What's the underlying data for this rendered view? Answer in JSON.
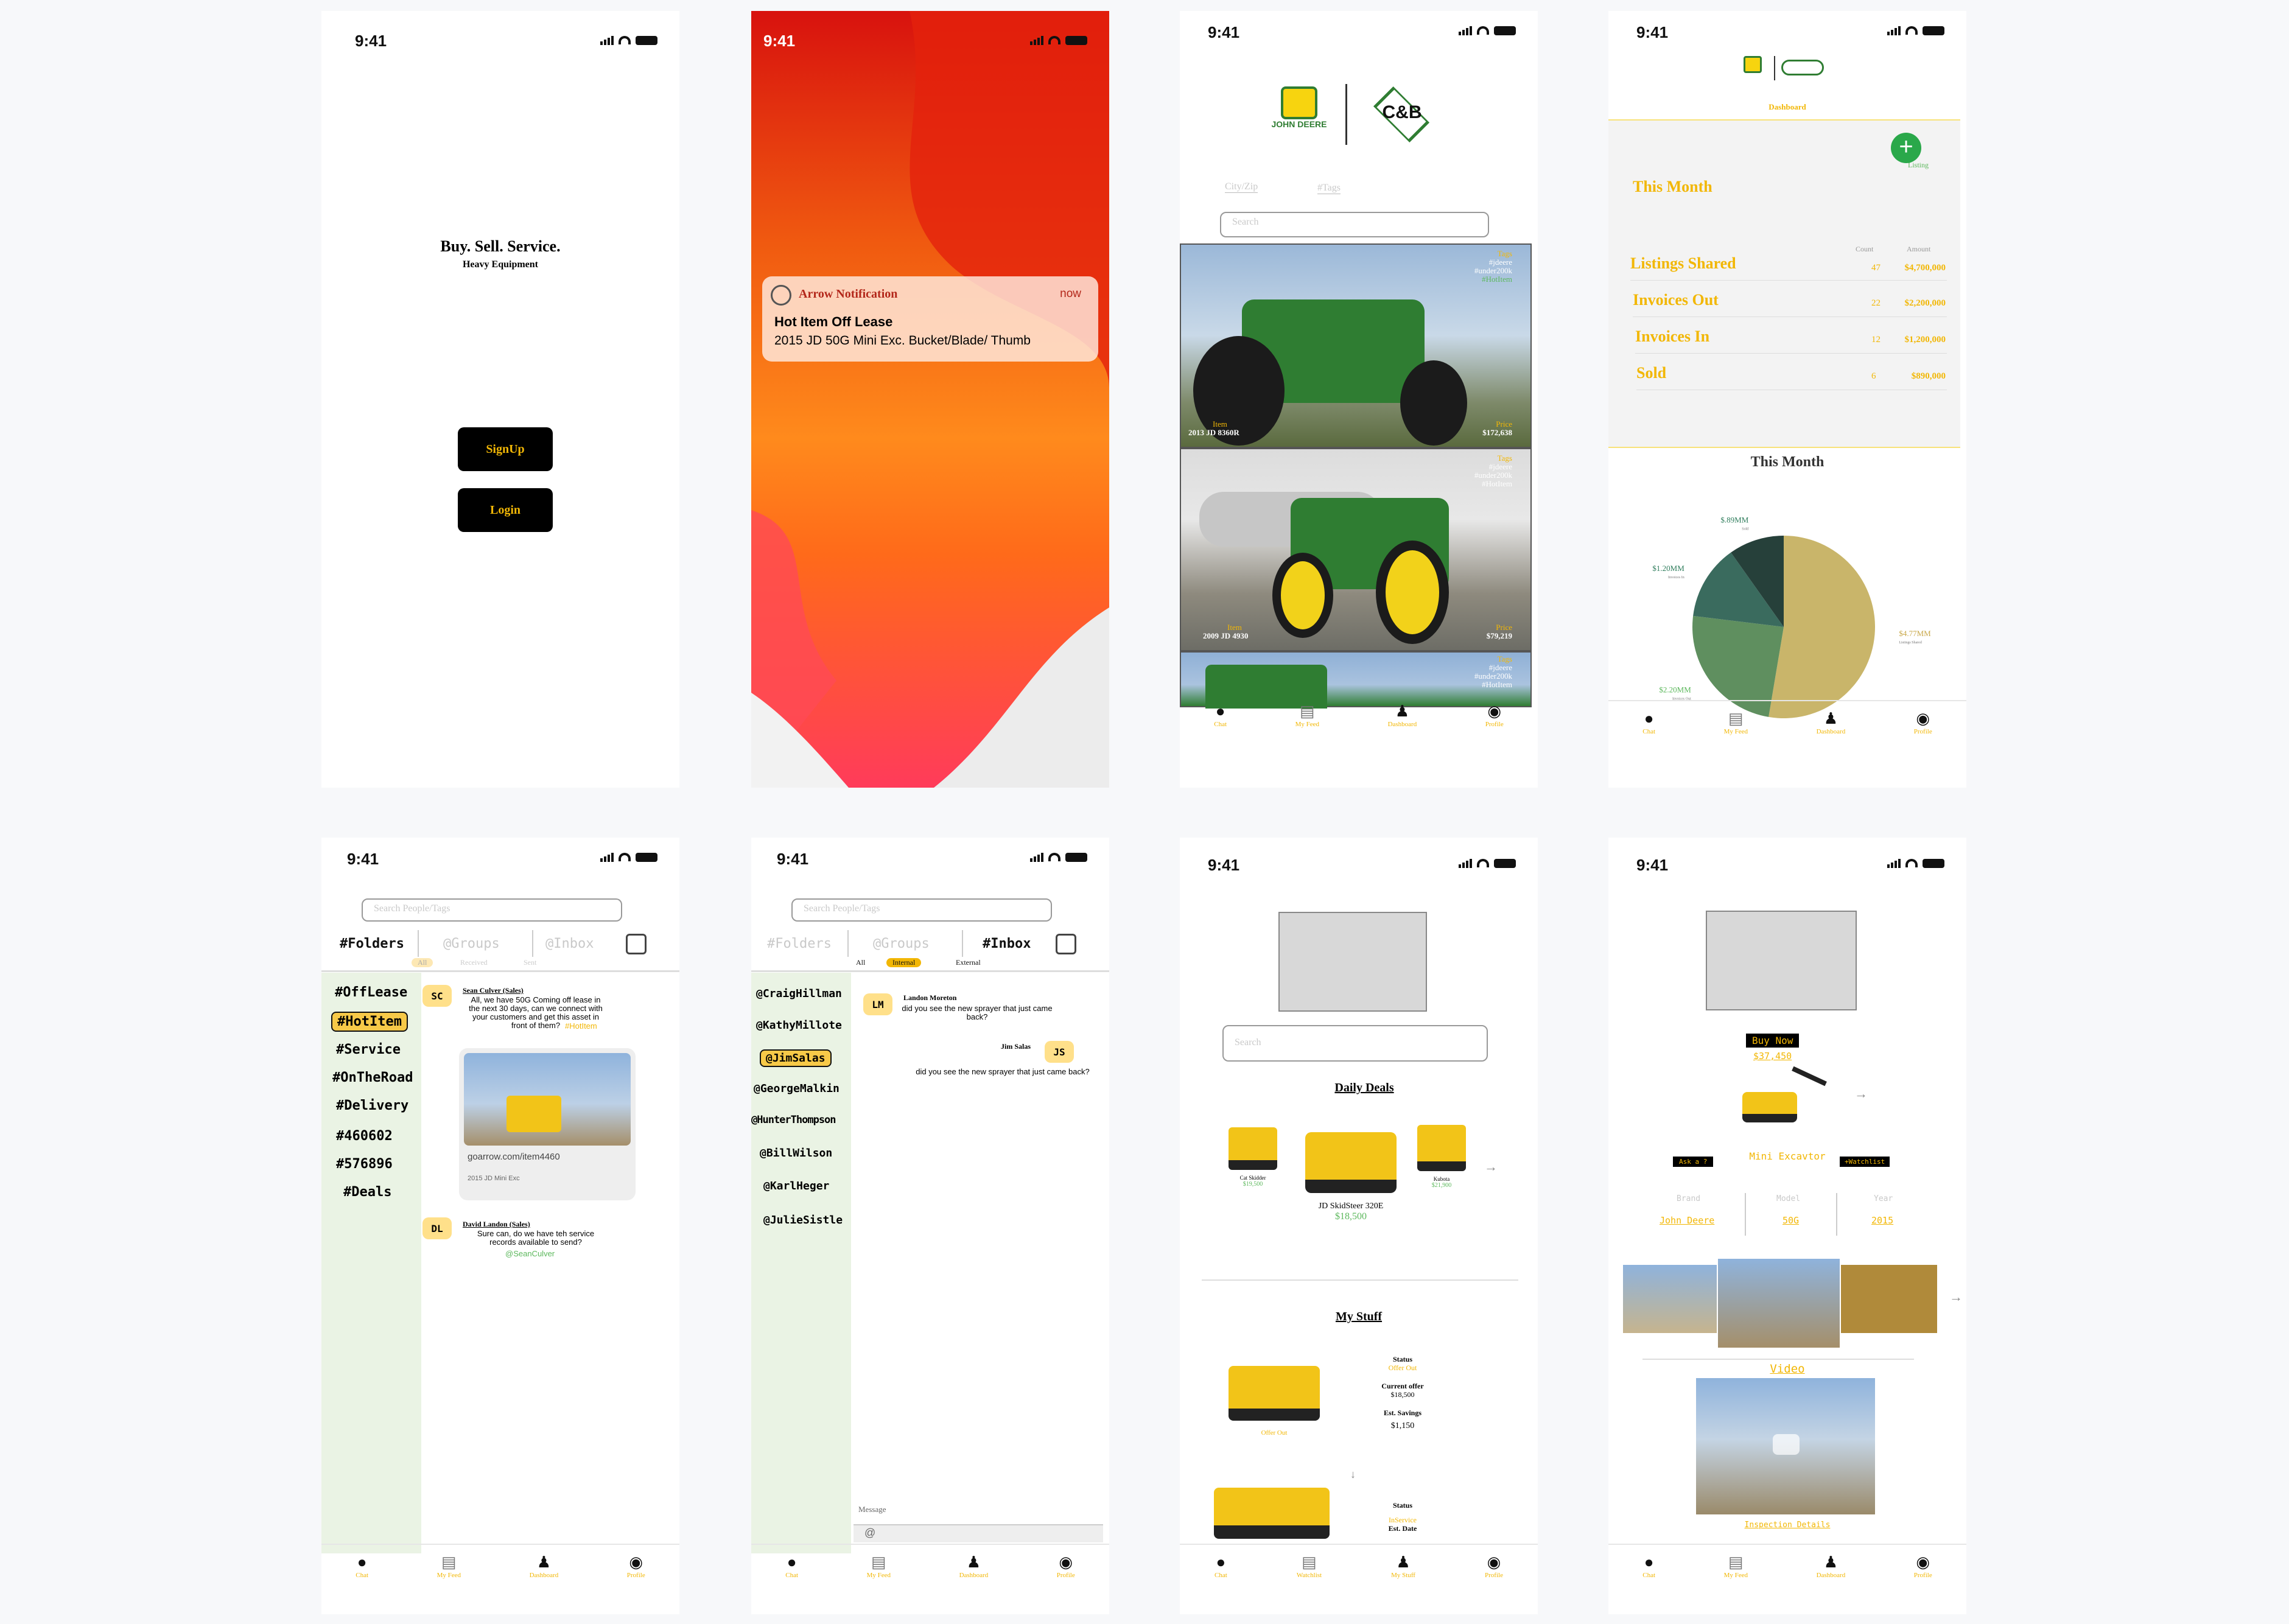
{
  "status_time": "9:41",
  "colors": {
    "accent_yellow": "#f2b705",
    "accent_green": "#5cb85c",
    "sidebar_bg": "#eaf3e4",
    "pie_tan": "#c9b56a",
    "pie_green": "#5f8f5f",
    "pie_teal": "#3a6b5e",
    "pie_dark": "#26403a"
  },
  "tabs_main": [
    {
      "label": "Chat",
      "icon": "chat-bubble-icon"
    },
    {
      "label": "My Feed",
      "icon": "feed-icon"
    },
    {
      "label": "Dashboard",
      "icon": "worker-icon"
    },
    {
      "label": "Profile",
      "icon": "profile-icon"
    }
  ],
  "tabs_mystuff": [
    {
      "label": "Chat",
      "icon": "chat-bubble-icon"
    },
    {
      "label": "Watchlist",
      "icon": "feed-icon"
    },
    {
      "label": "My Stuff",
      "icon": "worker-icon"
    },
    {
      "label": "Profile",
      "icon": "profile-icon"
    }
  ],
  "screen1": {
    "tagline": "Buy. Sell. Service.",
    "subtitle": "Heavy Equipment",
    "signup": "SignUp",
    "login": "Login"
  },
  "screen2": {
    "app": "Arrow Notification",
    "time": "now",
    "title": "Hot Item Off Lease",
    "body": "2015 JD 50G Mini Exc. Bucket/Blade/ Thumb"
  },
  "screen3": {
    "brand1": "JOHN DEERE",
    "brand2": "C&B",
    "filter_city": "City/Zip",
    "filter_tags": "#Tags",
    "search_placeholder": "Search",
    "listings": [
      {
        "tags_label": "Tags",
        "tags": [
          "#jdeere",
          "#under200k",
          "#HotItem"
        ],
        "item_label": "Item",
        "item": "2013 JD 8360R",
        "price_label": "Price",
        "price": "$172,638"
      },
      {
        "tags_label": "Tags",
        "tags": [
          "#jdeere",
          "#under200k",
          "#HotItem"
        ],
        "item_label": "Item",
        "item": "2009 JD 4930",
        "price_label": "Price",
        "price": "$79,219"
      },
      {
        "tags_label": "Tags",
        "tags": [
          "#jdeere",
          "#under200k",
          "#HotItem"
        ]
      }
    ]
  },
  "screen4": {
    "dashboard_label": "Dashboard",
    "listing_label": "Listing",
    "period": "This Month",
    "col_count": "Count",
    "col_amount": "Amount",
    "rows": [
      {
        "label": "Listings Shared",
        "count": "47",
        "amount": "$4,700,000"
      },
      {
        "label": "Invoices Out",
        "count": "22",
        "amount": "$2,200,000"
      },
      {
        "label": "Invoices In",
        "count": "12",
        "amount": "$1,200,000"
      },
      {
        "label": "Sold",
        "count": "6",
        "amount": "$890,000"
      }
    ],
    "chart_title": "This Month",
    "chart_data": {
      "type": "pie",
      "title": "This Month",
      "labels": [
        "$4.77MM",
        "$2.20MM",
        "$1.20MM",
        "$.89MM"
      ],
      "sublabels": [
        "Listings Shared",
        "Invoices Out",
        "Invoices In",
        "Sold"
      ],
      "values": [
        4.77,
        2.2,
        1.2,
        0.89
      ]
    }
  },
  "screen5": {
    "search_placeholder": "Search People/Tags",
    "tabs": [
      "#Folders",
      "@Groups",
      "@Inbox"
    ],
    "filters": [
      "All",
      "Received",
      "Sent"
    ],
    "folders": [
      "#OffLease",
      "#HotItem",
      "#Service",
      "#OnTheRoad",
      "#Delivery",
      "#460602",
      "#576896",
      "#Deals"
    ],
    "msg1": {
      "initials": "SC",
      "name": "Sean Culver (Sales)",
      "text": "All, we have 50G Coming off lease in the next 30 days, can we connect with your customers and get this asset in front of them?",
      "tag": "#HotItem",
      "link": "goarrow.com/item4460",
      "caption": "2015 JD Mini Exc"
    },
    "msg2": {
      "initials": "DL",
      "name": "David Landon (Sales)",
      "text": "Sure can, do we have teh service records available to send?",
      "mention": "@SeanCulver"
    }
  },
  "screen6": {
    "search_placeholder": "Search People/Tags",
    "tabs": [
      "#Folders",
      "@Groups",
      "#Inbox"
    ],
    "filters": [
      "All",
      "Internal",
      "External"
    ],
    "people": [
      "@CraigHillman",
      "@KathyMillote",
      "@JimSalas",
      "@GeorgeMalkin",
      "@HunterThompson",
      "@BillWilson",
      "@KarlHeger",
      "@JulieSistle"
    ],
    "msg1": {
      "initials": "LM",
      "name": "Landon Moreton",
      "text": "did you see the new sprayer that just came back?"
    },
    "msg2": {
      "initials": "JS",
      "name": "Jim Salas",
      "text": "did you see the new sprayer that just came back?"
    },
    "message_label": "Message"
  },
  "screen7": {
    "search_placeholder": "Search",
    "daily_deals": "Daily Deals",
    "deals": [
      {
        "name": "Cat Skidder",
        "price": "$19,500"
      },
      {
        "name": "JD SkidSteer 320E",
        "price": "$18,500"
      },
      {
        "name": "Kubota",
        "price": "$21,900"
      }
    ],
    "my_stuff": "My Stuff",
    "item1": {
      "status_label": "Status",
      "status": "Offer Out",
      "tag": "Offer Out",
      "offer_label": "Current offer",
      "offer": "$18,500",
      "savings_label": "Est. Savings",
      "savings": "$1,150"
    },
    "item2": {
      "status_label": "Status",
      "status": "InService",
      "date_label": "Est. Date"
    }
  },
  "screen8": {
    "buy_now": "Buy Now",
    "price": "$37,450",
    "ask": "Ask a ?",
    "title": "Mini Excavtor",
    "watchlist": "+Watchlist",
    "specs": [
      {
        "label": "Brand",
        "value": "John Deere"
      },
      {
        "label": "Model",
        "value": "50G"
      },
      {
        "label": "Year",
        "value": "2015"
      }
    ],
    "video": "Video",
    "inspection": "Inspection Details"
  }
}
